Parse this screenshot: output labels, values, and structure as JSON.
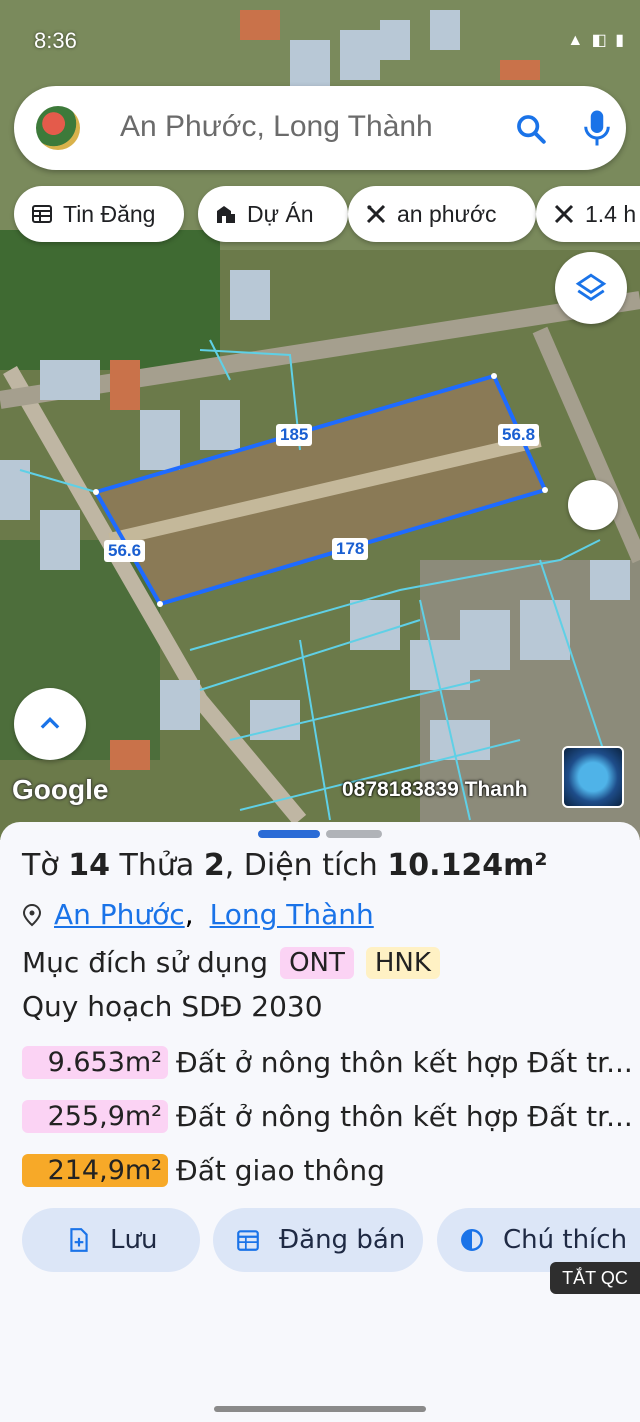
{
  "status_bar": {
    "time": "8:36"
  },
  "search": {
    "text": "An Phước, Long Thành"
  },
  "chips": [
    {
      "label": "Tin Đăng",
      "icon": "table-icon"
    },
    {
      "label": "Dự Án",
      "icon": "building-icon"
    },
    {
      "label": "an phước",
      "icon": "ruler-cross-icon"
    },
    {
      "label": "1.4 h",
      "icon": "ruler-cross-icon"
    }
  ],
  "map": {
    "edges": {
      "top": "185",
      "right": "56.8",
      "left": "56.6",
      "bottom": "178"
    },
    "google_label": "Google",
    "watermark": "0878183839 Thanh",
    "parcel_color": "#1e6bff"
  },
  "sheet": {
    "title_prefix": "Tờ",
    "sheet_no": "14",
    "parcel_label": "Thửa",
    "parcel_no": "2",
    "area_label": ", Diện tích",
    "area_value": "10.124m²",
    "location_1": "An Phước",
    "location_sep": ",",
    "location_2": "Long Thành",
    "purpose_label": "Mục đích sử dụng",
    "purpose_tags": [
      {
        "code": "ONT",
        "color": "#fbd3f4"
      },
      {
        "code": "HNK",
        "color": "#fff1c4"
      }
    ],
    "plan_title": "Quy hoạch SDĐ 2030",
    "zones": [
      {
        "area": "9.653m²",
        "desc": "Đất ở nông thôn kết hợp Đất tr...",
        "color": "#fbd3f4"
      },
      {
        "area": "255,9m²",
        "desc": "Đất ở nông thôn kết hợp Đất tr...",
        "color": "#fbd3f4"
      },
      {
        "area": "214,9m²",
        "desc": "Đất giao thông",
        "color": "#f7a928"
      }
    ],
    "actions": [
      {
        "label": "Lưu",
        "icon": "add-document-icon"
      },
      {
        "label": "Đăng bán",
        "icon": "calendar-icon"
      },
      {
        "label": "Chú thích",
        "icon": "half-circle-icon"
      }
    ],
    "ad_tag": "TẮT QC"
  }
}
